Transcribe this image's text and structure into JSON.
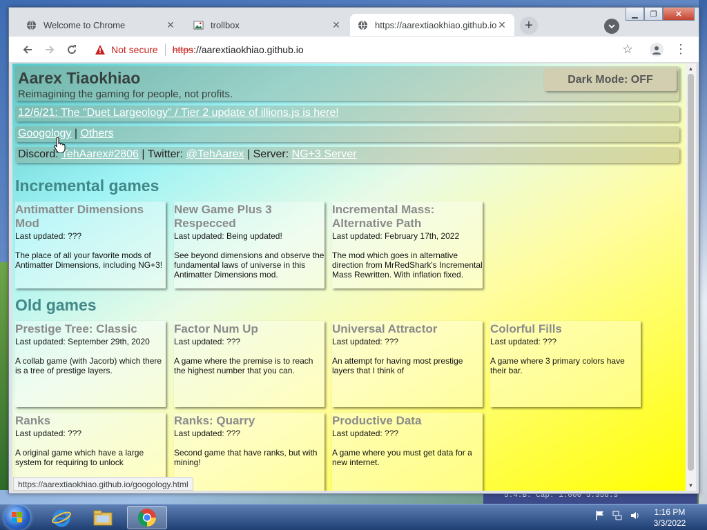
{
  "browser": {
    "tabs": [
      {
        "title": "Welcome to Chrome",
        "icon": "globe-icon",
        "active": false
      },
      {
        "title": "trollbox",
        "icon": "image-icon",
        "active": false
      },
      {
        "title": "https://aarextiaokhiao.github.io",
        "icon": "globe-icon",
        "active": true
      }
    ],
    "security_label": "Not secure",
    "url_scheme": "https",
    "url_rest": "://aarextiaokhiao.github.io",
    "status_url": "https://aarextiaokhiao.github.io/googology.html"
  },
  "page": {
    "title": "Aarex Tiaokhiao",
    "subtitle": "Reimagining the gaming for people, not profits.",
    "dark_mode": "Dark Mode: OFF",
    "announcement": "12/6/21: The \"Duet Largeology\" / Tier 2 update of illions.js is here!",
    "nav": {
      "googology": "Googology",
      "sep": "|",
      "others": "Others"
    },
    "social": {
      "discord_label": "Discord:",
      "discord": "TehAarex#2806",
      "twitter_label": "| Twitter:",
      "twitter": "@TehAarex",
      "server_label": "| Server:",
      "server": "NG+3 Server"
    },
    "incremental_heading": "Incremental games",
    "incremental": [
      {
        "title": "Antimatter Dimensions Mod",
        "updated": "Last updated: ???",
        "desc": "The place of all your favorite mods of Antimatter Dimensions, including NG+3!"
      },
      {
        "title": "New Game Plus 3 Respecced",
        "updated": "Last updated: Being updated!",
        "desc": "See beyond dimensions and observe the fundamental laws of universe in this Antimatter Dimensions mod."
      },
      {
        "title": "Incremental Mass: Alternative Path",
        "updated": "Last updated: February 17th, 2022",
        "desc": "The mod which goes in alternative direction from MrRedShark's Incremental Mass Rewritten. With inflation fixed."
      }
    ],
    "old_heading": "Old games",
    "old": [
      {
        "title": "Prestige Tree: Classic",
        "updated": "Last updated: September 29th, 2020",
        "desc": "A collab game (with Jacorb) which there is a tree of prestige layers."
      },
      {
        "title": "Factor Num Up",
        "updated": "Last updated: ???",
        "desc": "A game where the premise is to reach the highest number that you can."
      },
      {
        "title": "Universal Attractor",
        "updated": "Last updated: ???",
        "desc": "An attempt for having most prestige layers that I think of"
      },
      {
        "title": "Colorful Fills",
        "updated": "Last updated: ???",
        "desc": "A game where 3 primary colors have their bar."
      },
      {
        "title": "Ranks",
        "updated": "Last updated: ???",
        "desc": "A original game which have a large system for requiring to unlock"
      },
      {
        "title": "Ranks: Quarry",
        "updated": "Last updated: ???",
        "desc": "Second game that have ranks, but with mining!"
      },
      {
        "title": "Productive Data",
        "updated": "Last updated: ???",
        "desc": "A game where you must get data for a new internet."
      }
    ]
  },
  "background": {
    "behind_text": "5.4.B.  cap. 1.000    5.358.3"
  },
  "taskbar": {
    "time": "1:16 PM",
    "date": "3/3/2022"
  }
}
